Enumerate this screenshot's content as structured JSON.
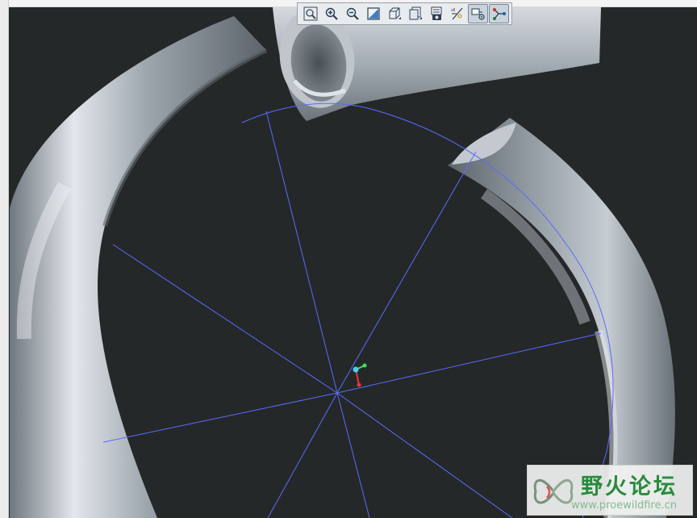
{
  "toolbar": {
    "buttons": [
      {
        "name": "refit",
        "icon": "zoom-fit-icon",
        "active": false
      },
      {
        "name": "zoom-in",
        "icon": "zoom-in-icon",
        "active": false
      },
      {
        "name": "zoom-out",
        "icon": "zoom-out-icon",
        "active": false
      },
      {
        "name": "reorient",
        "icon": "reorient-icon",
        "active": false
      },
      {
        "name": "display-style",
        "icon": "display-style-icon",
        "active": false
      },
      {
        "name": "saved-views",
        "icon": "saved-views-icon",
        "active": false
      },
      {
        "name": "view-manager",
        "icon": "view-manager-icon",
        "active": false
      },
      {
        "name": "datum-display",
        "icon": "datum-display-icon",
        "active": false
      },
      {
        "name": "annotation-display",
        "icon": "annotation-display-icon",
        "active": true
      },
      {
        "name": "spin-center",
        "icon": "spin-center-icon",
        "active": true
      }
    ]
  },
  "scene": {
    "background_color": "#252829",
    "model_color": "#8e969f",
    "datum_color": "#5a6bff",
    "csys_colors": {
      "x": "#e53935",
      "y": "#43e05a",
      "z": "#45d4ee"
    }
  },
  "watermark": {
    "title": "野火论坛",
    "url": "www.proewildfire.cn"
  }
}
